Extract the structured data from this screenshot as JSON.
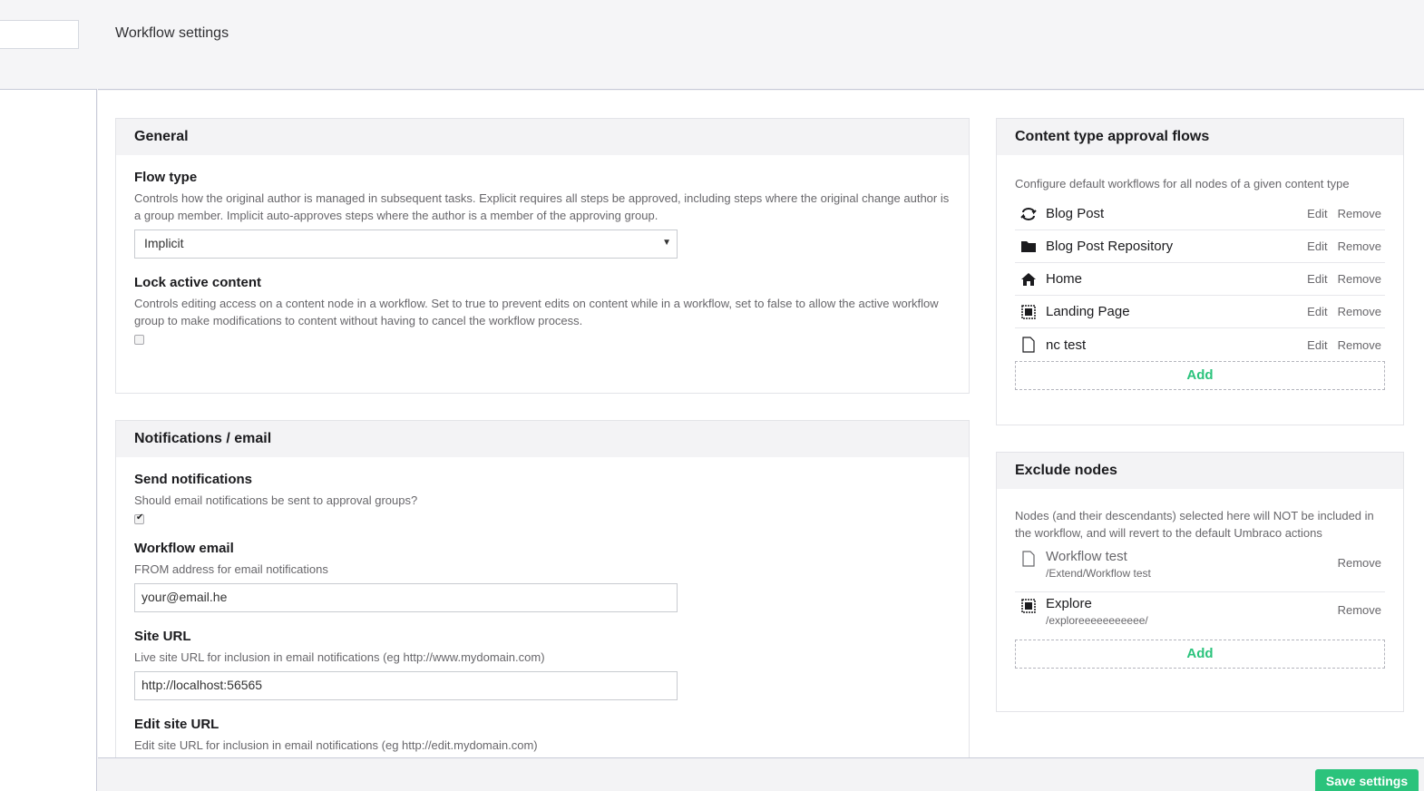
{
  "header": {
    "title": "Workflow settings"
  },
  "general": {
    "heading": "General",
    "flow_type": {
      "label": "Flow type",
      "description": "Controls how the original author is managed in subsequent tasks. Explicit requires all steps be approved, including steps where the original change author is a group member. Implicit auto-approves steps where the author is a member of the approving group.",
      "selected": "Implicit"
    },
    "lock_active": {
      "label": "Lock active content",
      "description": "Controls editing access on a content node in a workflow. Set to true to prevent edits on content while in a workflow, set to false to allow the active workflow group to make modifications to content without having to cancel the workflow process.",
      "checked": false
    }
  },
  "notifications": {
    "heading": "Notifications / email",
    "send": {
      "label": "Send notifications",
      "description": "Should email notifications be sent to approval groups?",
      "checked": true
    },
    "email": {
      "label": "Workflow email",
      "description": "FROM address for email notifications",
      "value": "your@email.he"
    },
    "site_url": {
      "label": "Site URL",
      "description": "Live site URL for inclusion in email notifications (eg http://www.mydomain.com)",
      "value": "http://localhost:56565"
    },
    "edit_site_url": {
      "label": "Edit site URL",
      "description": "Edit site URL for inclusion in email notifications (eg http://edit.mydomain.com)"
    }
  },
  "content_types": {
    "heading": "Content type approval flows",
    "description": "Configure default workflows for all nodes of a given content type",
    "items": [
      {
        "name": "Blog Post",
        "icon": "sync-icon"
      },
      {
        "name": "Blog Post Repository",
        "icon": "folder-icon"
      },
      {
        "name": "Home",
        "icon": "home-icon"
      },
      {
        "name": "Landing Page",
        "icon": "layout-icon"
      },
      {
        "name": "nc test",
        "icon": "document-icon"
      }
    ],
    "edit_label": "Edit",
    "remove_label": "Remove",
    "add_label": "Add"
  },
  "exclude": {
    "heading": "Exclude nodes",
    "description": "Nodes (and their descendants) selected here will NOT be included in the workflow, and will revert to the default Umbraco actions",
    "items": [
      {
        "name": "Workflow test",
        "path": "/Extend/Workflow test",
        "icon": "document-icon"
      },
      {
        "name": "Explore",
        "path": "/exploreeeeeeeeeee/",
        "icon": "layout-icon"
      }
    ],
    "remove_label": "Remove",
    "add_label": "Add"
  },
  "footer": {
    "save_label": "Save settings"
  },
  "colors": {
    "accent": "#2bc37c"
  }
}
